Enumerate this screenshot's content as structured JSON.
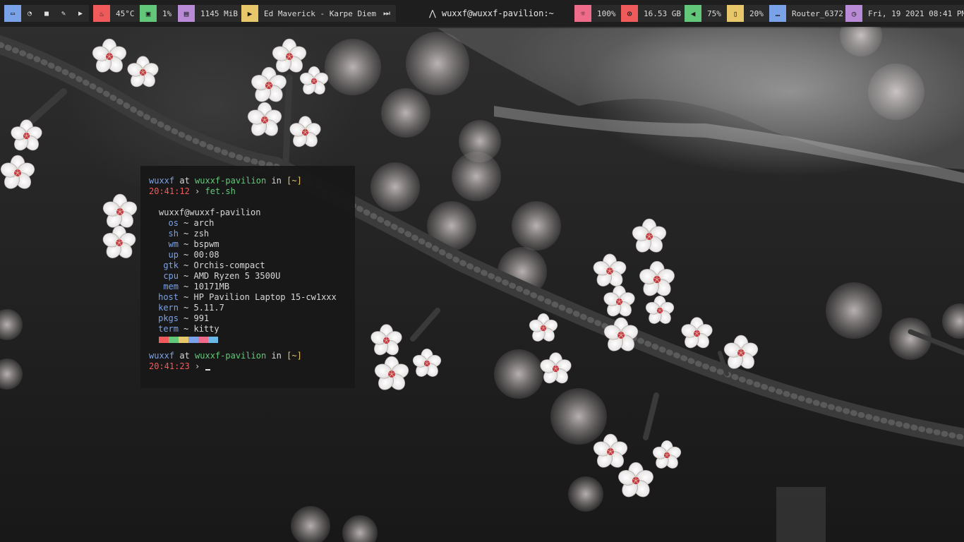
{
  "bar": {
    "workspaces": [
      {
        "icon": "terminal-icon",
        "glyph": "▭",
        "active": true
      },
      {
        "icon": "browser-icon",
        "glyph": "◔",
        "active": false
      },
      {
        "icon": "folder-icon",
        "glyph": "■",
        "active": false
      },
      {
        "icon": "editor-icon",
        "glyph": "✎",
        "active": false
      },
      {
        "icon": "media-icon",
        "glyph": "▶",
        "active": false
      }
    ],
    "temp": {
      "value": "45°C",
      "color": "#ef5b5b",
      "glyph": "♨"
    },
    "cpu": {
      "value": "1%",
      "color": "#63c77a",
      "glyph": "▣"
    },
    "memory": {
      "value": "1145 MiB",
      "color": "#b98bd6",
      "glyph": "▤"
    },
    "music": {
      "value": "Ed Maverick - Karpe Diem",
      "color": "#e8c66a",
      "glyph": "▶",
      "next_glyph": "⏭"
    },
    "window_title": {
      "glyph": "⋀",
      "text": "wuxxf@wuxxf-pavilion:~"
    },
    "brightness": {
      "value": "100%",
      "color": "#ef6b8a",
      "glyph": "☼"
    },
    "disk": {
      "value": "16.53 GB",
      "color": "#ef5b5b",
      "glyph": "⊙"
    },
    "volume": {
      "value": "75%",
      "color": "#63c77a",
      "glyph": "◀"
    },
    "battery": {
      "value": "20%",
      "color": "#e8c66a",
      "glyph": "▯"
    },
    "network": {
      "value": "Router_6372",
      "color": "#7aa2e8",
      "glyph": "…"
    },
    "clock": {
      "value": "Fri, 19 2021 08:41 PM",
      "color": "#b98bd6",
      "glyph": "◷"
    }
  },
  "terminal": {
    "prompt1": {
      "user": "wuxxf",
      "at": "at",
      "host": "wuxxf-pavilion",
      "in": "in",
      "dir": "[~]",
      "time": "20:41:12",
      "arrow": "›",
      "command": "fet.sh"
    },
    "fetch_header": "wuxxf@wuxxf-pavilion",
    "fetch": [
      {
        "key": "os",
        "value": "arch"
      },
      {
        "key": "sh",
        "value": "zsh"
      },
      {
        "key": "wm",
        "value": "bspwm"
      },
      {
        "key": "up",
        "value": "00:08"
      },
      {
        "key": "gtk",
        "value": "Orchis-compact"
      },
      {
        "key": "cpu",
        "value": "AMD Ryzen 5 3500U"
      },
      {
        "key": "mem",
        "value": "10171MB"
      },
      {
        "key": "host",
        "value": "HP Pavilion Laptop 15-cw1xxx"
      },
      {
        "key": "kern",
        "value": "5.11.7"
      },
      {
        "key": "pkgs",
        "value": "991"
      },
      {
        "key": "term",
        "value": "kitty"
      }
    ],
    "separator": "~",
    "palette": [
      "#ef5b5b",
      "#63c77a",
      "#e8c66a",
      "#7aa2e8",
      "#ef6b8a",
      "#6ab8e8"
    ],
    "prompt2": {
      "user": "wuxxf",
      "at": "at",
      "host": "wuxxf-pavilion",
      "in": "in",
      "dir": "[~]",
      "time": "20:41:23",
      "arrow": "›"
    }
  }
}
